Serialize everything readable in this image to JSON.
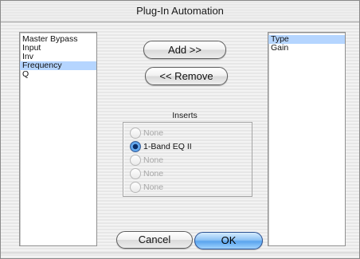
{
  "window": {
    "title": "Plug-In Automation"
  },
  "left_list": {
    "items": [
      {
        "label": "Master Bypass",
        "selected": false
      },
      {
        "label": "Input",
        "selected": false
      },
      {
        "label": "Inv",
        "selected": false
      },
      {
        "label": "Frequency",
        "selected": true
      },
      {
        "label": "Q",
        "selected": false
      }
    ]
  },
  "right_list": {
    "items": [
      {
        "label": "Type",
        "selected": true
      },
      {
        "label": "Gain",
        "selected": false
      }
    ]
  },
  "buttons": {
    "add": "Add >>",
    "remove": "<< Remove",
    "cancel": "Cancel",
    "ok": "OK"
  },
  "inserts": {
    "label": "Inserts",
    "options": [
      {
        "label": "None",
        "enabled": false,
        "selected": false
      },
      {
        "label": "1-Band EQ II",
        "enabled": true,
        "selected": true
      },
      {
        "label": "None",
        "enabled": false,
        "selected": false
      },
      {
        "label": "None",
        "enabled": false,
        "selected": false
      },
      {
        "label": "None",
        "enabled": false,
        "selected": false
      }
    ]
  },
  "colors": {
    "selection": "#b5d5ff",
    "default_button": "#5aa4ee",
    "disabled_text": "#a7a7a7"
  }
}
